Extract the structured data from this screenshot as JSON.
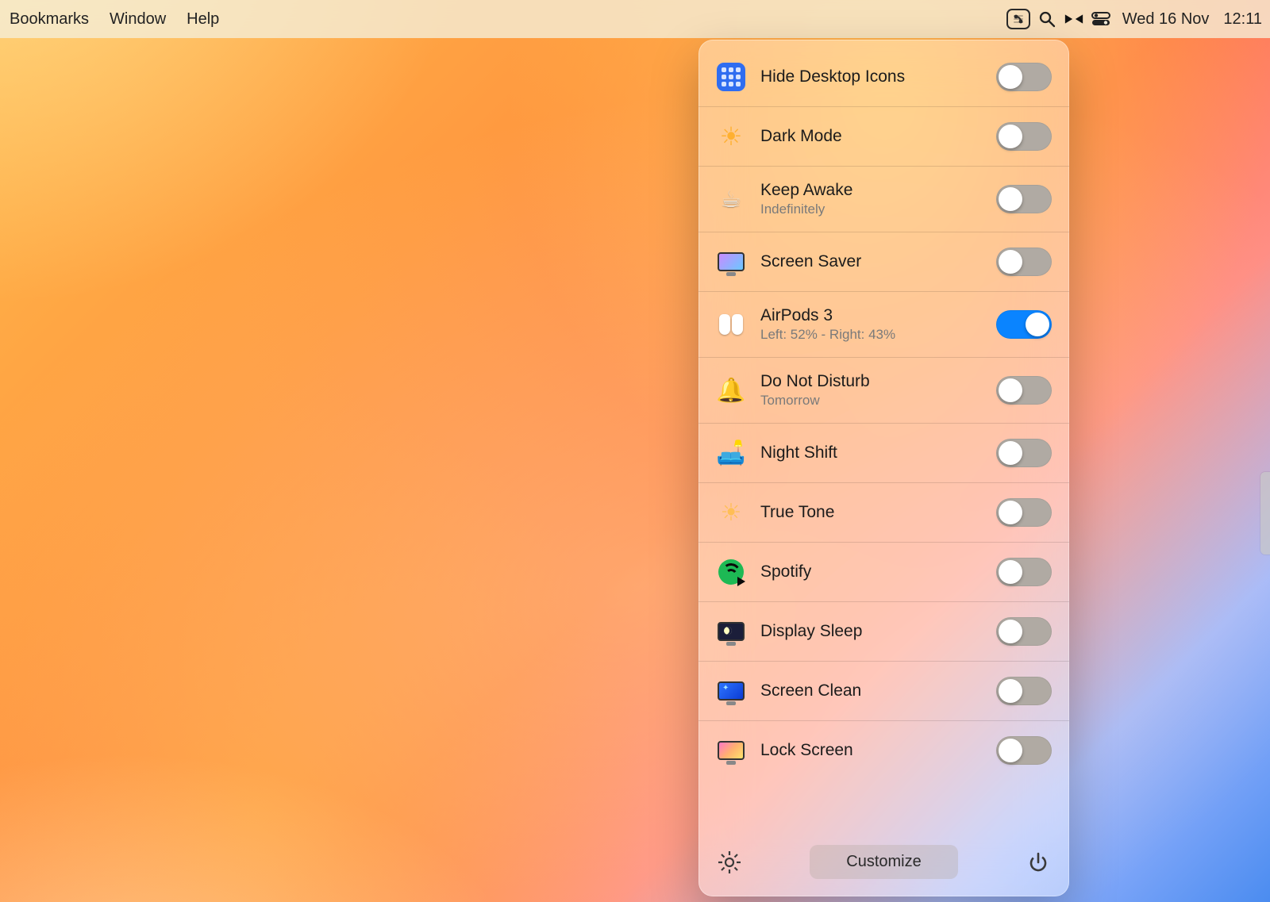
{
  "menubar": {
    "menus": [
      "Bookmarks",
      "Window",
      "Help"
    ],
    "date": "Wed 16 Nov",
    "time": "12:11"
  },
  "panel": {
    "items": [
      {
        "id": "hide-desktop-icons",
        "label": "Hide Desktop Icons",
        "sub": "",
        "on": false,
        "icon": "grid"
      },
      {
        "id": "dark-mode",
        "label": "Dark Mode",
        "sub": "",
        "on": false,
        "icon": "sun"
      },
      {
        "id": "keep-awake",
        "label": "Keep Awake",
        "sub": "Indefinitely",
        "on": false,
        "icon": "cup"
      },
      {
        "id": "screen-saver",
        "label": "Screen Saver",
        "sub": "",
        "on": false,
        "icon": "monitor"
      },
      {
        "id": "airpods-3",
        "label": "AirPods 3",
        "sub": "Left: 52% - Right: 43%",
        "on": true,
        "icon": "airpods"
      },
      {
        "id": "do-not-disturb",
        "label": "Do Not Disturb",
        "sub": "Tomorrow",
        "on": false,
        "icon": "bell"
      },
      {
        "id": "night-shift",
        "label": "Night Shift",
        "sub": "",
        "on": false,
        "icon": "lamp"
      },
      {
        "id": "true-tone",
        "label": "True Tone",
        "sub": "",
        "on": false,
        "icon": "tone"
      },
      {
        "id": "spotify",
        "label": "Spotify",
        "sub": "",
        "on": false,
        "icon": "spotify"
      },
      {
        "id": "display-sleep",
        "label": "Display Sleep",
        "sub": "",
        "on": false,
        "icon": "moonmon"
      },
      {
        "id": "screen-clean",
        "label": "Screen Clean",
        "sub": "",
        "on": false,
        "icon": "cleanmon"
      },
      {
        "id": "lock-screen",
        "label": "Lock Screen",
        "sub": "",
        "on": false,
        "icon": "lockmon"
      }
    ],
    "customize_label": "Customize"
  }
}
